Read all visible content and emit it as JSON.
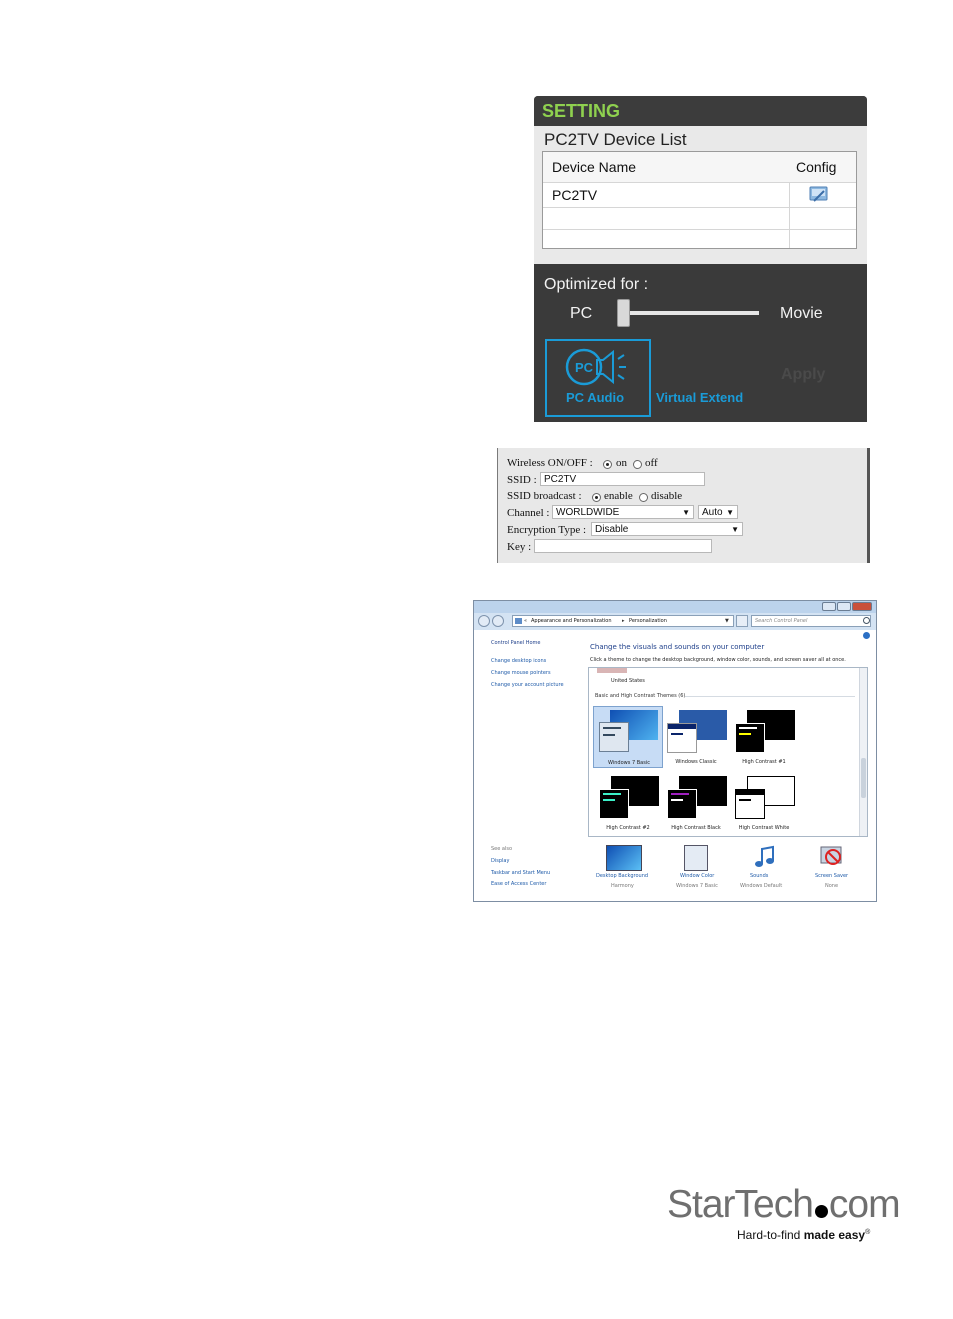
{
  "setting_panel": {
    "header": "SETTING",
    "device_list_title": "PC2TV Device List",
    "table": {
      "columns": [
        "Device Name",
        "Config"
      ],
      "rows": [
        [
          "PC2TV",
          ""
        ],
        [
          "",
          ""
        ],
        [
          "",
          ""
        ]
      ]
    },
    "optimized_for": "Optimized for :",
    "slider": {
      "left_label": "PC",
      "right_label": "Movie",
      "value_fraction": 0.0
    },
    "pc_audio_label": "PC Audio",
    "pc_audio_icon_text": "PC",
    "virtual_extend_label": "Virtual Extend",
    "apply_label": "Apply",
    "colors": {
      "header_green": "#8fd14f",
      "accent_blue": "#1a9bd7",
      "dark_bg": "#3a3a3a"
    }
  },
  "wireless_form": {
    "wireless_label": "Wireless ON/OFF :",
    "on_label": "on",
    "off_label": "off",
    "wireless_selected": "on",
    "ssid_label": "SSID :",
    "ssid_value": "PC2TV",
    "broadcast_label": "SSID broadcast :",
    "enable_label": "enable",
    "disable_label": "disable",
    "broadcast_selected": "enable",
    "channel_label": "Channel :",
    "channel_region": "WORLDWIDE",
    "channel_value": "Auto",
    "encryption_label": "Encryption Type :",
    "encryption_value": "Disable",
    "key_label": "Key :",
    "key_value": ""
  },
  "windows_personalization": {
    "breadcrumb": [
      "Appearance and Personalization",
      "Personalization"
    ],
    "breadcrumb_prefix": "«",
    "breadcrumb_sep": "▸",
    "search_placeholder": "Search Control Panel",
    "left_nav": {
      "home": "Control Panel Home",
      "links": [
        "Change desktop icons",
        "Change mouse pointers",
        "Change your account picture"
      ],
      "see_also_title": "See also",
      "see_also": [
        "Display",
        "Taskbar and Start Menu",
        "Ease of Access Center"
      ]
    },
    "heading": "Change the visuals and sounds on your computer",
    "description": "Click a theme to change the desktop background, window color, sounds, and screen saver all at once.",
    "partial_theme_label": "United States",
    "section_title": "Basic and High Contrast Themes (6)",
    "themes": [
      {
        "name": "Windows 7 Basic",
        "selected": true
      },
      {
        "name": "Windows Classic",
        "selected": false
      },
      {
        "name": "High Contrast #1",
        "selected": false
      },
      {
        "name": "High Contrast #2",
        "selected": false
      },
      {
        "name": "High Contrast Black",
        "selected": false
      },
      {
        "name": "High Contrast White",
        "selected": false
      }
    ],
    "bottom_items": [
      {
        "title": "Desktop Background",
        "subtitle": "Harmony"
      },
      {
        "title": "Window Color",
        "subtitle": "Windows 7 Basic"
      },
      {
        "title": "Sounds",
        "subtitle": "Windows Default"
      },
      {
        "title": "Screen Saver",
        "subtitle": "None"
      }
    ],
    "colors": {
      "link_blue": "#1e5aa8",
      "heading_blue": "#1e3f8a",
      "selection": "#c7dcf5"
    }
  },
  "brand": {
    "logo_left": "StarTech",
    "logo_right": "com",
    "tagline_regular": "Hard-to-find",
    "tagline_bold": "made easy",
    "registered_mark": "®"
  }
}
